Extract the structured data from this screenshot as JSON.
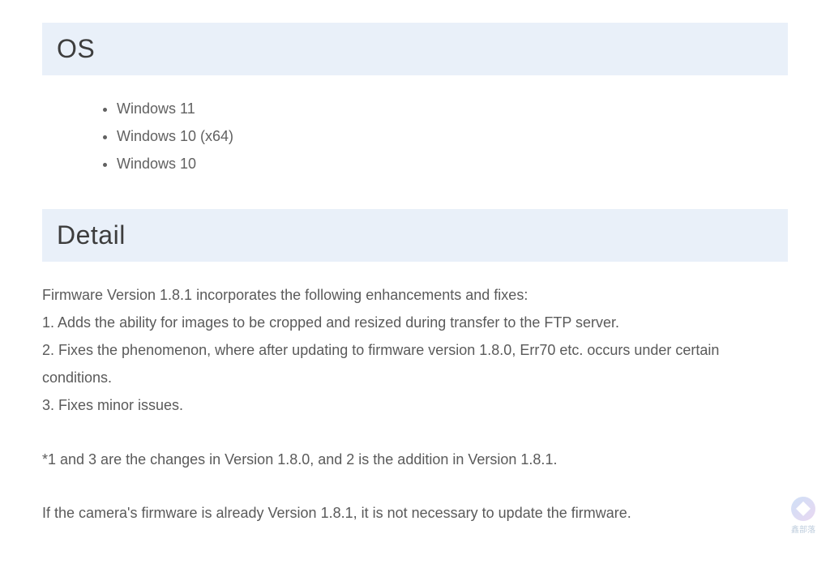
{
  "sections": {
    "os": {
      "title": "OS",
      "items": [
        "Windows 11",
        "Windows 10 (x64)",
        "Windows 10"
      ]
    },
    "detail": {
      "title": "Detail",
      "intro": "Firmware Version 1.8.1 incorporates the following enhancements and fixes:",
      "changes": [
        "1. Adds the ability for images to be cropped and resized during transfer to the FTP server.",
        "2. Fixes the phenomenon, where after updating to firmware version 1.8.0, Err70 etc. occurs under certain conditions.",
        "3. Fixes minor issues."
      ],
      "note": "*1 and 3 are the changes in Version 1.8.0, and 2 is the addition in Version 1.8.1.",
      "final": "If the camera's firmware is already Version 1.8.1, it is not necessary to update the firmware."
    }
  },
  "watermark": {
    "text": "鑫部落"
  }
}
